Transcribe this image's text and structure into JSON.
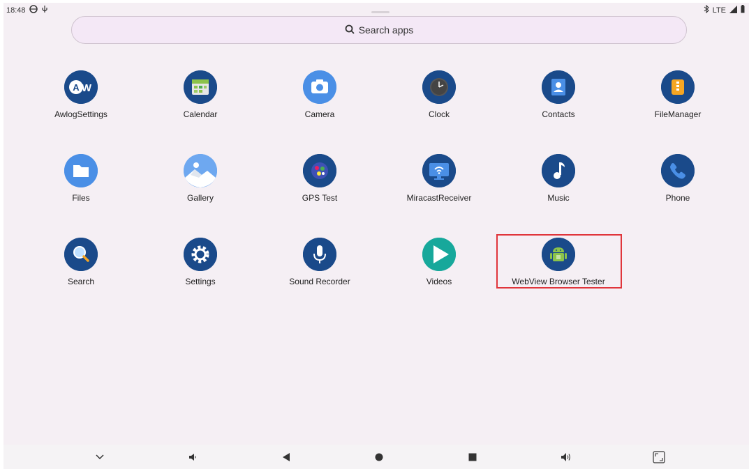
{
  "status_bar": {
    "time": "18:48",
    "network": "LTE"
  },
  "search": {
    "label": "Search apps"
  },
  "apps": [
    {
      "label": "AwlogSettings",
      "icon": "awlog-icon",
      "color": "#1a4a8a",
      "glyph": "AW"
    },
    {
      "label": "Calendar",
      "icon": "calendar-icon",
      "color": "#1a4a8a",
      "glyph": ""
    },
    {
      "label": "Camera",
      "icon": "camera-icon",
      "color": "#4a8fe6",
      "glyph": ""
    },
    {
      "label": "Clock",
      "icon": "clock-icon",
      "color": "#1a4a8a",
      "glyph": ""
    },
    {
      "label": "Contacts",
      "icon": "contacts-icon",
      "color": "#1a4a8a",
      "glyph": ""
    },
    {
      "label": "FileManager",
      "icon": "filemanager-icon",
      "color": "#1a4a8a",
      "glyph": ""
    },
    {
      "label": "Files",
      "icon": "files-icon",
      "color": "#4a8fe6",
      "glyph": ""
    },
    {
      "label": "Gallery",
      "icon": "gallery-icon",
      "color": "#6ea8f0",
      "glyph": ""
    },
    {
      "label": "GPS Test",
      "icon": "gps-icon",
      "color": "#1a4a8a",
      "glyph": ""
    },
    {
      "label": "MiracastReceiver",
      "icon": "miracast-icon",
      "color": "#1a4a8a",
      "glyph": ""
    },
    {
      "label": "Music",
      "icon": "music-icon",
      "color": "#1a4a8a",
      "glyph": "♪"
    },
    {
      "label": "Phone",
      "icon": "phone-icon",
      "color": "#1a4a8a",
      "glyph": ""
    },
    {
      "label": "Search",
      "icon": "search-app-icon",
      "color": "#1a4a8a",
      "glyph": ""
    },
    {
      "label": "Settings",
      "icon": "settings-icon",
      "color": "#1a4a8a",
      "glyph": ""
    },
    {
      "label": "Sound Recorder",
      "icon": "microphone-icon",
      "color": "#1a4a8a",
      "glyph": ""
    },
    {
      "label": "Videos",
      "icon": "play-icon",
      "color": "#17a89b",
      "glyph": ""
    },
    {
      "label": "WebView Browser Tester",
      "icon": "android-icon",
      "color": "#1a4a8a",
      "glyph": ""
    }
  ],
  "nav": [
    {
      "name": "chevron-down-icon"
    },
    {
      "name": "volume-down-icon"
    },
    {
      "name": "back-icon"
    },
    {
      "name": "home-icon"
    },
    {
      "name": "recents-icon"
    },
    {
      "name": "volume-up-icon"
    },
    {
      "name": "screenshot-icon"
    }
  ]
}
